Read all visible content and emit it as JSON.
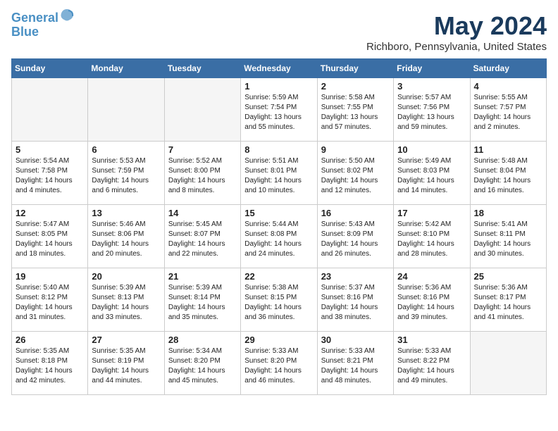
{
  "header": {
    "logo_line1": "General",
    "logo_line2": "Blue",
    "month": "May 2024",
    "location": "Richboro, Pennsylvania, United States"
  },
  "weekdays": [
    "Sunday",
    "Monday",
    "Tuesday",
    "Wednesday",
    "Thursday",
    "Friday",
    "Saturday"
  ],
  "weeks": [
    [
      {
        "day": "",
        "empty": true
      },
      {
        "day": "",
        "empty": true
      },
      {
        "day": "",
        "empty": true
      },
      {
        "day": "1",
        "rise": "5:59 AM",
        "set": "7:54 PM",
        "daylight": "13 hours and 55 minutes."
      },
      {
        "day": "2",
        "rise": "5:58 AM",
        "set": "7:55 PM",
        "daylight": "13 hours and 57 minutes."
      },
      {
        "day": "3",
        "rise": "5:57 AM",
        "set": "7:56 PM",
        "daylight": "13 hours and 59 minutes."
      },
      {
        "day": "4",
        "rise": "5:55 AM",
        "set": "7:57 PM",
        "daylight": "14 hours and 2 minutes."
      }
    ],
    [
      {
        "day": "5",
        "rise": "5:54 AM",
        "set": "7:58 PM",
        "daylight": "14 hours and 4 minutes."
      },
      {
        "day": "6",
        "rise": "5:53 AM",
        "set": "7:59 PM",
        "daylight": "14 hours and 6 minutes."
      },
      {
        "day": "7",
        "rise": "5:52 AM",
        "set": "8:00 PM",
        "daylight": "14 hours and 8 minutes."
      },
      {
        "day": "8",
        "rise": "5:51 AM",
        "set": "8:01 PM",
        "daylight": "14 hours and 10 minutes."
      },
      {
        "day": "9",
        "rise": "5:50 AM",
        "set": "8:02 PM",
        "daylight": "14 hours and 12 minutes."
      },
      {
        "day": "10",
        "rise": "5:49 AM",
        "set": "8:03 PM",
        "daylight": "14 hours and 14 minutes."
      },
      {
        "day": "11",
        "rise": "5:48 AM",
        "set": "8:04 PM",
        "daylight": "14 hours and 16 minutes."
      }
    ],
    [
      {
        "day": "12",
        "rise": "5:47 AM",
        "set": "8:05 PM",
        "daylight": "14 hours and 18 minutes."
      },
      {
        "day": "13",
        "rise": "5:46 AM",
        "set": "8:06 PM",
        "daylight": "14 hours and 20 minutes."
      },
      {
        "day": "14",
        "rise": "5:45 AM",
        "set": "8:07 PM",
        "daylight": "14 hours and 22 minutes."
      },
      {
        "day": "15",
        "rise": "5:44 AM",
        "set": "8:08 PM",
        "daylight": "14 hours and 24 minutes."
      },
      {
        "day": "16",
        "rise": "5:43 AM",
        "set": "8:09 PM",
        "daylight": "14 hours and 26 minutes."
      },
      {
        "day": "17",
        "rise": "5:42 AM",
        "set": "8:10 PM",
        "daylight": "14 hours and 28 minutes."
      },
      {
        "day": "18",
        "rise": "5:41 AM",
        "set": "8:11 PM",
        "daylight": "14 hours and 30 minutes."
      }
    ],
    [
      {
        "day": "19",
        "rise": "5:40 AM",
        "set": "8:12 PM",
        "daylight": "14 hours and 31 minutes."
      },
      {
        "day": "20",
        "rise": "5:39 AM",
        "set": "8:13 PM",
        "daylight": "14 hours and 33 minutes."
      },
      {
        "day": "21",
        "rise": "5:39 AM",
        "set": "8:14 PM",
        "daylight": "14 hours and 35 minutes."
      },
      {
        "day": "22",
        "rise": "5:38 AM",
        "set": "8:15 PM",
        "daylight": "14 hours and 36 minutes."
      },
      {
        "day": "23",
        "rise": "5:37 AM",
        "set": "8:16 PM",
        "daylight": "14 hours and 38 minutes."
      },
      {
        "day": "24",
        "rise": "5:36 AM",
        "set": "8:16 PM",
        "daylight": "14 hours and 39 minutes."
      },
      {
        "day": "25",
        "rise": "5:36 AM",
        "set": "8:17 PM",
        "daylight": "14 hours and 41 minutes."
      }
    ],
    [
      {
        "day": "26",
        "rise": "5:35 AM",
        "set": "8:18 PM",
        "daylight": "14 hours and 42 minutes."
      },
      {
        "day": "27",
        "rise": "5:35 AM",
        "set": "8:19 PM",
        "daylight": "14 hours and 44 minutes."
      },
      {
        "day": "28",
        "rise": "5:34 AM",
        "set": "8:20 PM",
        "daylight": "14 hours and 45 minutes."
      },
      {
        "day": "29",
        "rise": "5:33 AM",
        "set": "8:20 PM",
        "daylight": "14 hours and 46 minutes."
      },
      {
        "day": "30",
        "rise": "5:33 AM",
        "set": "8:21 PM",
        "daylight": "14 hours and 48 minutes."
      },
      {
        "day": "31",
        "rise": "5:33 AM",
        "set": "8:22 PM",
        "daylight": "14 hours and 49 minutes."
      },
      {
        "day": "",
        "empty": true
      }
    ]
  ],
  "labels": {
    "sunrise": "Sunrise:",
    "sunset": "Sunset:",
    "daylight": "Daylight:"
  }
}
